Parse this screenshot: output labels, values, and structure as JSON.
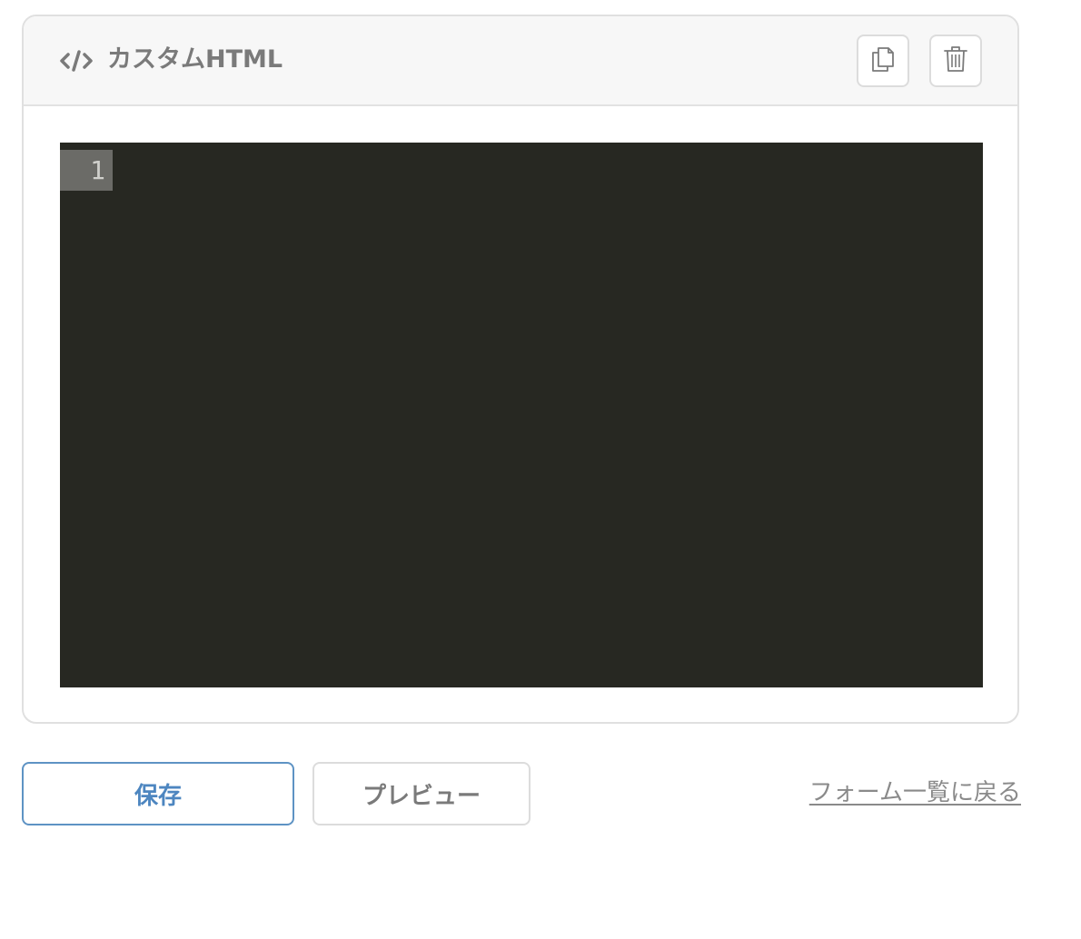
{
  "block": {
    "title": "カスタムHTML",
    "icon": "code-icon",
    "actions": [
      {
        "name": "copy",
        "icon": "copy-icon"
      },
      {
        "name": "delete",
        "icon": "trash-icon"
      }
    ]
  },
  "editor": {
    "line_numbers": [
      "1"
    ],
    "content": "",
    "theme_background": "#272822"
  },
  "footer": {
    "save_label": "保存",
    "preview_label": "プレビュー",
    "back_link_label": "フォーム一覧に戻る"
  },
  "colors": {
    "accent": "#4d86c0",
    "text_muted": "#7a7a7a",
    "border": "#dcdcdc"
  }
}
